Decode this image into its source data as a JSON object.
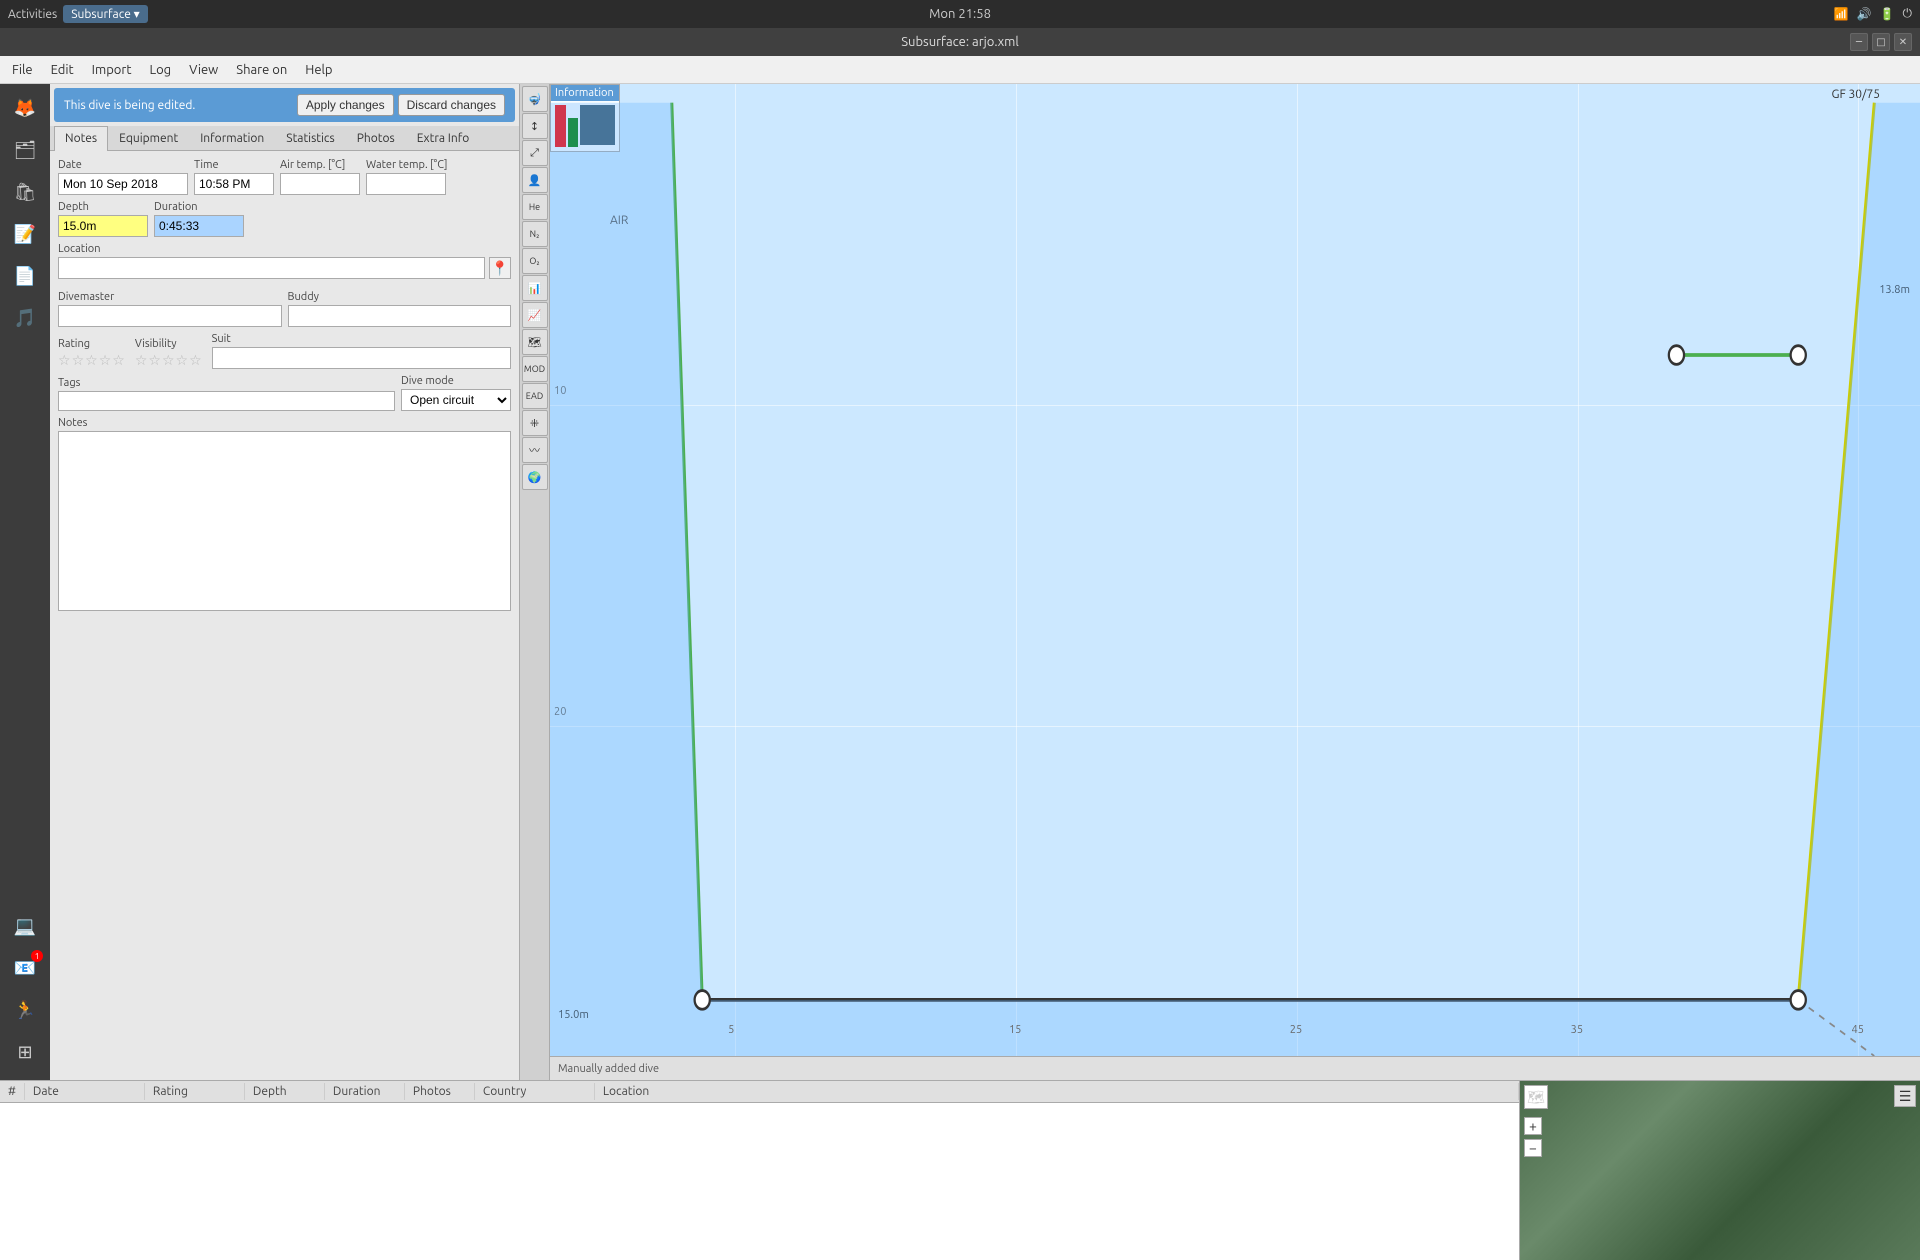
{
  "topbar": {
    "activities": "Activities",
    "app_name": "Subsurface ▾",
    "clock": "Mon 21:58",
    "window_title": "Subsurface: arjo.xml"
  },
  "menubar": {
    "items": [
      "File",
      "Edit",
      "Import",
      "Log",
      "View",
      "Share on",
      "Help"
    ]
  },
  "edit_notice": {
    "text": "This dive is being edited.",
    "apply": "Apply changes",
    "discard": "Discard changes"
  },
  "tabs": [
    "Notes",
    "Equipment",
    "Information",
    "Statistics",
    "Photos",
    "Extra Info"
  ],
  "form": {
    "date_label": "Date",
    "date_value": "Mon 10 Sep 2018",
    "time_label": "Time",
    "time_value": "10:58 PM",
    "airtemp_label": "Air temp. [°C]",
    "watertemp_label": "Water temp. [°C]",
    "depth_label": "Depth",
    "depth_value": "15.0m",
    "duration_label": "Duration",
    "duration_value": "0:45:33",
    "location_label": "Location",
    "divemaster_label": "Divemaster",
    "buddy_label": "Buddy",
    "rating_label": "Rating",
    "visibility_label": "Visibility",
    "suit_label": "Suit",
    "tags_label": "Tags",
    "dive_mode_label": "Dive mode",
    "dive_mode_value": "Open circuit",
    "notes_label": "Notes"
  },
  "plot": {
    "gf_label": "GF 30/75",
    "air_label": "AIR",
    "depth_bottom": "15.0m",
    "depth_annotation": "13.8m",
    "manually_added": "Manually added dive",
    "grid_depths": [
      10,
      20
    ],
    "grid_times": [
      5,
      15,
      25,
      35,
      45
    ]
  },
  "info_panel": {
    "title": "Information"
  },
  "table": {
    "columns": [
      "#",
      "Date",
      "Rating",
      "Depth",
      "Duration",
      "Photos",
      "Country",
      "Location"
    ]
  },
  "map": {
    "zoom_in": "+",
    "zoom_out": "−"
  }
}
